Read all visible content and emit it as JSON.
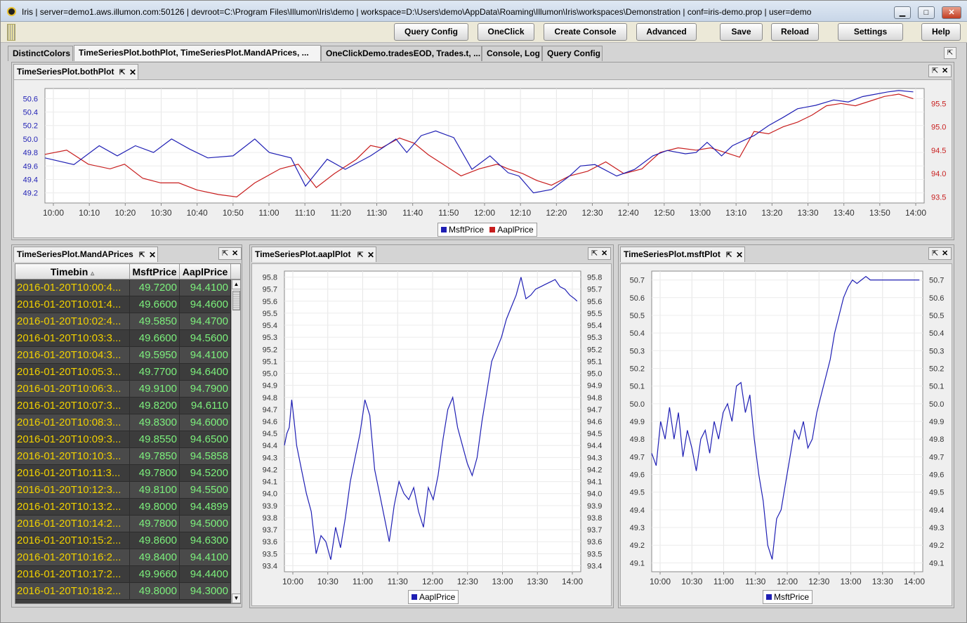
{
  "window": {
    "title": "Iris  |  server=demo1.aws.illumon.com:50126 | devroot=C:\\Program Files\\Illumon\\Iris\\demo | workspace=D:\\Users\\demo\\AppData\\Roaming\\Illumon\\Iris\\workspaces\\Demonstration | conf=iris-demo.prop | user=demo",
    "min_glyph": "▁",
    "max_glyph": "□",
    "close_glyph": "✕"
  },
  "toolbar": {
    "buttons": [
      "Query Config",
      "OneClick",
      "Create Console",
      "Advanced",
      "Save",
      "Reload",
      "Settings",
      "Help"
    ]
  },
  "tabs": [
    "DistinctColors",
    "TimeSeriesPlot.bothPlot, TimeSeriesPlot.MandAPrices, ...",
    "OneClickDemo.tradesEOD, Trades.t, ...",
    "Console, Log",
    "Query Config"
  ],
  "glyphs": {
    "pin": "⇱",
    "close": "✕",
    "sort": "▵",
    "up": "▲",
    "down": "▼"
  },
  "panels": {
    "both_plot": {
      "tab": "TimeSeriesPlot.bothPlot"
    },
    "mand_a_prices": {
      "tab": "TimeSeriesPlot.MandAPrices"
    },
    "aapl_plot": {
      "tab": "TimeSeriesPlot.aaplPlot"
    },
    "msft_plot": {
      "tab": "TimeSeriesPlot.msftPlot"
    }
  },
  "table": {
    "columns": [
      "Timebin",
      "MsftPrice",
      "AaplPrice"
    ],
    "rows": [
      [
        "2016-01-20T10:00:4...",
        "49.7200",
        "94.4100"
      ],
      [
        "2016-01-20T10:01:4...",
        "49.6600",
        "94.4600"
      ],
      [
        "2016-01-20T10:02:4...",
        "49.5850",
        "94.4700"
      ],
      [
        "2016-01-20T10:03:3...",
        "49.6600",
        "94.5600"
      ],
      [
        "2016-01-20T10:04:3...",
        "49.5950",
        "94.4100"
      ],
      [
        "2016-01-20T10:05:3...",
        "49.7700",
        "94.6400"
      ],
      [
        "2016-01-20T10:06:3...",
        "49.9100",
        "94.7900"
      ],
      [
        "2016-01-20T10:07:3...",
        "49.8200",
        "94.6110"
      ],
      [
        "2016-01-20T10:08:3...",
        "49.8300",
        "94.6000"
      ],
      [
        "2016-01-20T10:09:3...",
        "49.8550",
        "94.6500"
      ],
      [
        "2016-01-20T10:10:3...",
        "49.7850",
        "94.5858"
      ],
      [
        "2016-01-20T10:11:3...",
        "49.7800",
        "94.5200"
      ],
      [
        "2016-01-20T10:12:3...",
        "49.8100",
        "94.5500"
      ],
      [
        "2016-01-20T10:13:2...",
        "49.8000",
        "94.4899"
      ],
      [
        "2016-01-20T10:14:2...",
        "49.7800",
        "94.5000"
      ],
      [
        "2016-01-20T10:15:2...",
        "49.8600",
        "94.6300"
      ],
      [
        "2016-01-20T10:16:2...",
        "49.8400",
        "94.4100"
      ],
      [
        "2016-01-20T10:17:2...",
        "49.9660",
        "94.4400"
      ],
      [
        "2016-01-20T10:18:2...",
        "49.8000",
        "94.3000"
      ]
    ]
  },
  "chart_data": [
    {
      "type": "line",
      "id": "bothPlot",
      "x_ticks": [
        "10:00",
        "10:10",
        "10:20",
        "10:30",
        "10:40",
        "10:50",
        "11:00",
        "11:10",
        "11:20",
        "11:30",
        "11:40",
        "11:50",
        "12:00",
        "12:10",
        "12:20",
        "12:30",
        "12:40",
        "12:50",
        "13:00",
        "13:10",
        "13:20",
        "13:30",
        "13:40",
        "13:50",
        "14:00"
      ],
      "xlim": [
        0,
        243
      ],
      "ylim_left": [
        49.05,
        50.75
      ],
      "ylim_right": [
        93.37,
        95.82
      ],
      "yticks_left": [
        "49.2",
        "49.4",
        "49.6",
        "49.8",
        "50.0",
        "50.2",
        "50.4",
        "50.6"
      ],
      "yticks_right": [
        "93.5",
        "94.0",
        "94.5",
        "95.0",
        "95.5"
      ],
      "colors": {
        "msft": "#1f1fb4",
        "aapl": "#c81e1e"
      },
      "legend": [
        "MsftPrice",
        "AaplPrice"
      ],
      "series": [
        {
          "name": "MsftPrice",
          "axis": "left",
          "color": "#1f1fb4",
          "x": [
            0,
            8,
            15,
            20,
            25,
            30,
            35,
            40,
            45,
            52,
            58,
            62,
            68,
            72,
            78,
            83,
            90,
            97,
            100,
            104,
            108,
            113,
            118,
            123,
            128,
            131,
            135,
            140,
            145,
            148,
            152,
            158,
            163,
            168,
            172,
            177,
            180,
            183,
            187,
            190,
            196,
            200,
            204,
            208,
            213,
            218,
            222,
            226,
            229,
            233,
            236,
            240
          ],
          "values": [
            49.72,
            49.62,
            49.9,
            49.75,
            49.9,
            49.8,
            50.0,
            49.85,
            49.72,
            49.75,
            50.0,
            49.8,
            49.72,
            49.3,
            49.7,
            49.55,
            49.75,
            50.0,
            49.8,
            50.05,
            50.12,
            50.02,
            49.55,
            49.75,
            49.5,
            49.45,
            49.2,
            49.25,
            49.45,
            49.6,
            49.62,
            49.45,
            49.55,
            49.75,
            49.83,
            49.78,
            49.8,
            49.95,
            49.75,
            49.9,
            50.05,
            50.2,
            50.32,
            50.45,
            50.5,
            50.58,
            50.55,
            50.63,
            50.66,
            50.7,
            50.72,
            50.7
          ]
        },
        {
          "name": "AaplPrice",
          "axis": "right",
          "color": "#c81e1e",
          "x": [
            0,
            6,
            12,
            18,
            22,
            27,
            32,
            37,
            42,
            48,
            53,
            58,
            65,
            70,
            75,
            80,
            86,
            90,
            93,
            98,
            102,
            106,
            110,
            115,
            120,
            125,
            128,
            132,
            136,
            140,
            145,
            150,
            155,
            160,
            165,
            170,
            175,
            180,
            184,
            188,
            192,
            196,
            200,
            204,
            208,
            212,
            216,
            220,
            224,
            228,
            232,
            236,
            240
          ],
          "values": [
            94.41,
            94.5,
            94.2,
            94.1,
            94.2,
            93.9,
            93.8,
            93.8,
            93.65,
            93.55,
            93.5,
            93.8,
            94.1,
            94.2,
            93.7,
            94.0,
            94.3,
            94.6,
            94.55,
            94.76,
            94.65,
            94.4,
            94.2,
            93.95,
            94.1,
            94.2,
            94.1,
            94.0,
            93.85,
            93.75,
            93.95,
            94.05,
            94.25,
            94.0,
            94.1,
            94.45,
            94.55,
            94.5,
            94.55,
            94.45,
            94.35,
            94.9,
            94.85,
            95.0,
            95.1,
            95.25,
            95.45,
            95.5,
            95.45,
            95.55,
            95.65,
            95.7,
            95.6
          ]
        }
      ]
    },
    {
      "type": "line",
      "id": "aaplPlot",
      "x_ticks": [
        "10:00",
        "10:30",
        "11:00",
        "11:30",
        "12:00",
        "12:30",
        "13:00",
        "13:30",
        "14:00"
      ],
      "xlim": [
        0,
        243
      ],
      "ylim": [
        93.35,
        95.85
      ],
      "yticks": [
        "93.4",
        "93.5",
        "93.6",
        "93.7",
        "93.8",
        "93.9",
        "94.0",
        "94.1",
        "94.2",
        "94.3",
        "94.4",
        "94.5",
        "94.6",
        "94.7",
        "94.8",
        "94.9",
        "95.0",
        "95.1",
        "95.2",
        "95.3",
        "95.4",
        "95.5",
        "95.6",
        "95.7",
        "95.8"
      ],
      "legend": [
        "AaplPrice"
      ],
      "color": "#1f1fb4",
      "x": [
        0,
        2,
        4,
        6,
        8,
        10,
        14,
        18,
        22,
        26,
        30,
        34,
        38,
        42,
        46,
        50,
        54,
        58,
        62,
        66,
        70,
        74,
        78,
        82,
        86,
        90,
        94,
        98,
        102,
        106,
        110,
        114,
        118,
        122,
        126,
        130,
        134,
        138,
        142,
        146,
        150,
        154,
        158,
        162,
        166,
        170,
        174,
        178,
        182,
        186,
        190,
        194,
        198,
        202,
        206,
        210,
        214,
        218,
        222,
        226,
        230,
        234,
        238,
        240
      ],
      "values": [
        94.4,
        94.5,
        94.55,
        94.78,
        94.6,
        94.4,
        94.2,
        94.0,
        93.85,
        93.5,
        93.65,
        93.6,
        93.45,
        93.72,
        93.55,
        93.8,
        94.1,
        94.3,
        94.5,
        94.78,
        94.65,
        94.2,
        94.0,
        93.8,
        93.6,
        93.9,
        94.1,
        94.0,
        93.95,
        94.05,
        93.85,
        93.72,
        94.05,
        93.95,
        94.15,
        94.45,
        94.7,
        94.8,
        94.55,
        94.4,
        94.25,
        94.15,
        94.3,
        94.6,
        94.85,
        95.1,
        95.2,
        95.3,
        95.45,
        95.55,
        95.65,
        95.8,
        95.62,
        95.65,
        95.7,
        95.72,
        95.74,
        95.76,
        95.78,
        95.72,
        95.7,
        95.65,
        95.62,
        95.6
      ]
    },
    {
      "type": "line",
      "id": "msftPlot",
      "x_ticks": [
        "10:00",
        "10:30",
        "11:00",
        "11:30",
        "12:00",
        "12:30",
        "13:00",
        "13:30",
        "14:00"
      ],
      "xlim": [
        0,
        243
      ],
      "ylim": [
        49.05,
        50.75
      ],
      "yticks": [
        "49.1",
        "49.2",
        "49.3",
        "49.4",
        "49.5",
        "49.6",
        "49.7",
        "49.8",
        "49.9",
        "50.0",
        "50.1",
        "50.2",
        "50.3",
        "50.4",
        "50.5",
        "50.6",
        "50.7"
      ],
      "legend": [
        "MsftPrice"
      ],
      "color": "#1f1fb4",
      "x": [
        0,
        4,
        8,
        12,
        16,
        20,
        24,
        28,
        32,
        36,
        40,
        44,
        48,
        52,
        56,
        60,
        64,
        68,
        72,
        76,
        80,
        84,
        88,
        92,
        96,
        100,
        104,
        108,
        112,
        116,
        120,
        124,
        128,
        132,
        136,
        140,
        144,
        148,
        152,
        156,
        160,
        164,
        168,
        172,
        176,
        180,
        184,
        188,
        192,
        196,
        200,
        204,
        208,
        212,
        216,
        220,
        224,
        228,
        232,
        236,
        240
      ],
      "values": [
        49.72,
        49.65,
        49.9,
        49.8,
        49.98,
        49.8,
        49.95,
        49.7,
        49.85,
        49.75,
        49.62,
        49.8,
        49.85,
        49.72,
        49.9,
        49.8,
        49.95,
        50.0,
        49.9,
        50.1,
        50.12,
        49.95,
        50.05,
        49.8,
        49.6,
        49.45,
        49.2,
        49.12,
        49.35,
        49.4,
        49.55,
        49.7,
        49.85,
        49.8,
        49.9,
        49.75,
        49.8,
        49.95,
        50.05,
        50.15,
        50.25,
        50.4,
        50.5,
        50.6,
        50.66,
        50.7,
        50.68,
        50.7,
        50.72,
        50.7,
        50.7,
        50.7,
        50.7,
        50.7,
        50.7,
        50.7,
        50.7,
        50.7,
        50.7,
        50.7,
        50.7
      ]
    }
  ]
}
